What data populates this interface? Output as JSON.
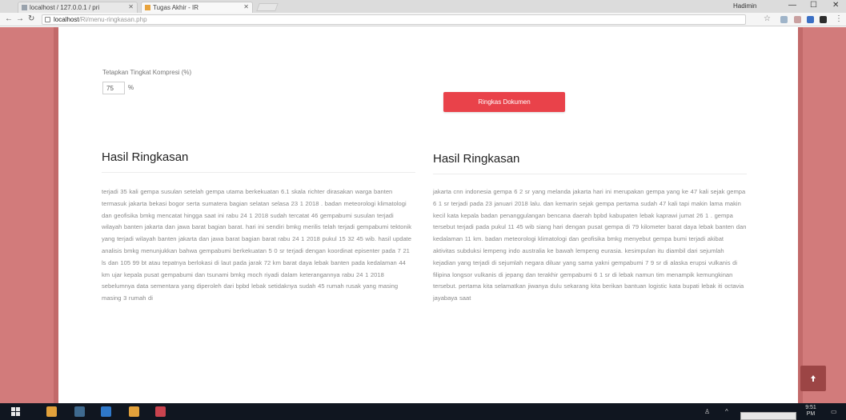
{
  "browser": {
    "tabs": [
      {
        "label": "localhost / 127.0.0.1 / pri"
      },
      {
        "label": "Tugas Akhir - IR"
      }
    ],
    "profile_name": "Hadimin",
    "address": {
      "host": "localhost",
      "path": "/Ri/menu-ringkasan.php"
    }
  },
  "form": {
    "compress_label": "Tetapkan Tingkat Kompresi (%)",
    "compress_value": "75",
    "percent_sign": "%",
    "summarize_button": "Ringkas Dokumen"
  },
  "results": [
    {
      "title": "Hasil Ringkasan",
      "text": "terjadi 35 kali gempa susulan setelah gempa utama berkekuatan 6.1 skala richter dirasakan warga banten termasuk jakarta bekasi bogor serta sumatera bagian selatan selasa 23 1 2018 . badan meteorologi klimatologi dan geofisika bmkg mencatat hingga saat ini rabu 24 1 2018 sudah tercatat 46 gempabumi susulan terjadi wilayah banten jakarta dan jawa barat bagian barat. hari ini sendiri bmkg merilis telah terjadi gempabumi tektonik yang terjadi wilayah banten jakarta dan jawa barat bagian barat rabu 24 1 2018 pukul 15 32 45 wib. hasil update analisis bmkg menunjukkan bahwa gempabumi berkekuatan 5 0 sr terjadi dengan koordinat episenter pada 7 21 ls dan 105 99 bt atau tepatnya berlokasi di laut pada jarak 72 km barat daya lebak banten pada kedalaman 44 km ujar kepala pusat gempabumi dan tsunami bmkg moch riyadi dalam keterangannya rabu 24 1 2018 sebelumnya data sementara yang diperoleh dari bpbd lebak setidaknya sudah 45 rumah rusak yang masing masing 3 rumah di"
    },
    {
      "title": "Hasil Ringkasan",
      "text": "jakarta cnn indonesia gempa 6 2 sr yang melanda jakarta hari ini merupakan gempa yang ke 47 kali sejak gempa 6 1 sr terjadi pada 23 januari 2018 lalu. dan kemarin sejak gempa pertama sudah 47 kali tapi makin lama makin kecil kata kepala badan penanggulangan bencana daerah bpbd kabupaten lebak kaprawi jumat 26 1 . gempa tersebut terjadi pada pukul 11 45 wib siang hari dengan pusat gempa di 79 kilometer barat daya lebak banten dan kedalaman 11 km. badan meteorologi klimatologi dan geofisika bmkg menyebut gempa bumi terjadi akibat aktivitas subduksi lempeng indo australia ke bawah lempeng eurasia. kesimpulan itu diambil dari sejumlah kejadian yang terjadi di sejumlah negara diluar yang sama yakni gempabumi 7 9 sr di alaska erupsi vulkanis di filipina longsor vulkanis di jepang dan terakhir gempabumi 6 1 sr di lebak namun tim menampik kemungkinan tersebut. pertama kita selamatkan jiwanya dulu sekarang kita berikan bantuan logistic kata bupati lebak iti octavia jayabaya saat"
    }
  ],
  "taskbar": {
    "clock_time": "9:51 PM"
  },
  "colors": {
    "side_panel": "#d27b7b",
    "button": "#e9424a",
    "back_to_top": "#9c4545"
  }
}
